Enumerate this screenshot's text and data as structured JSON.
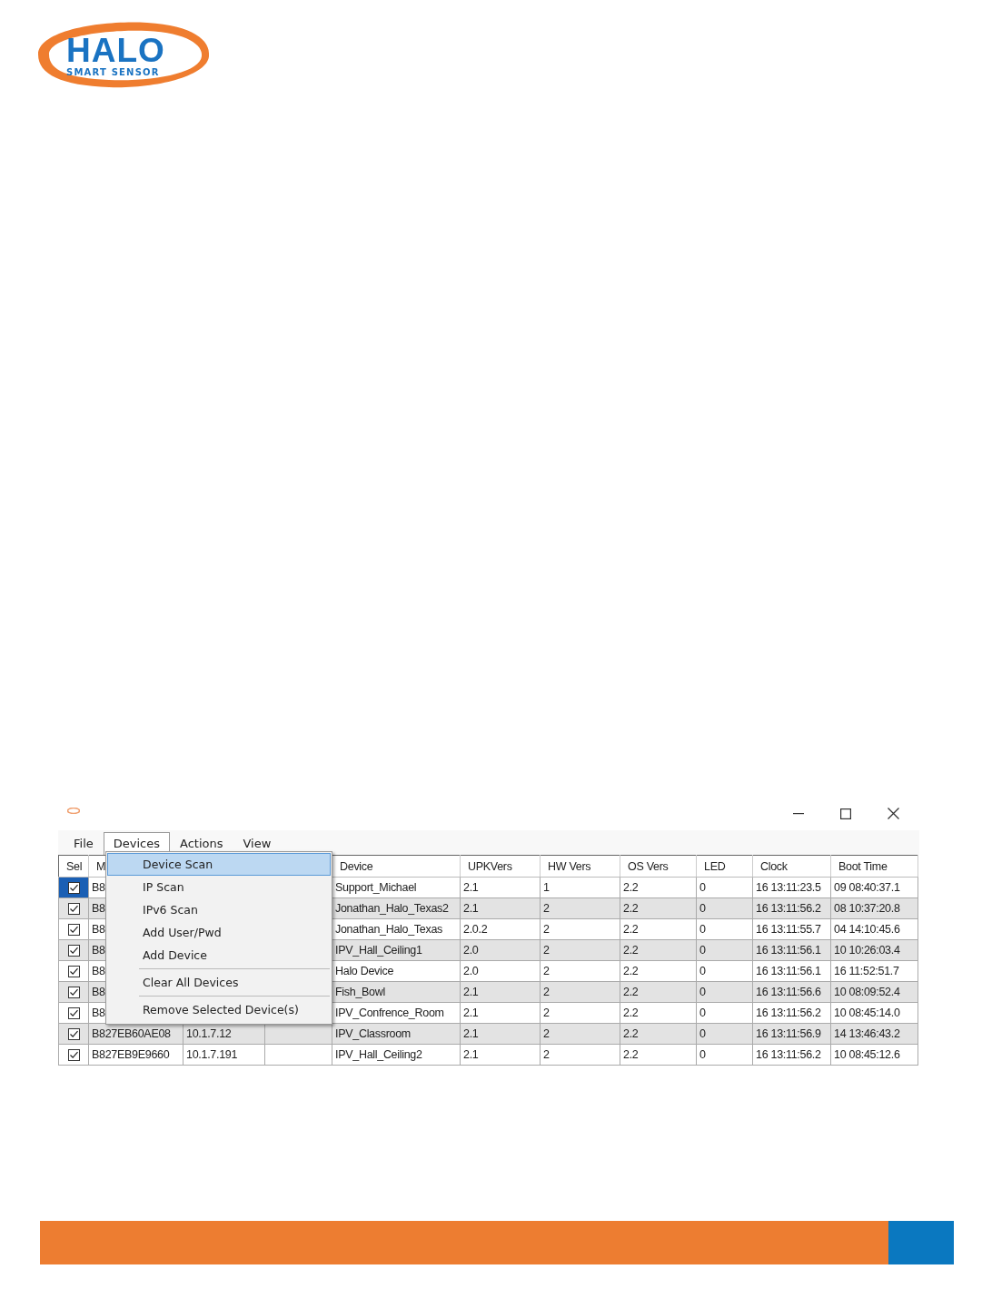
{
  "logo": {
    "title": "HALO",
    "subtitle": "SMART SENSOR"
  },
  "menubar": [
    {
      "label": "File",
      "open": false
    },
    {
      "label": "Devices",
      "open": true
    },
    {
      "label": "Actions",
      "open": false
    },
    {
      "label": "View",
      "open": false
    }
  ],
  "menu": [
    {
      "kind": "item",
      "label": "Device Scan",
      "selected": true
    },
    {
      "kind": "item",
      "label": "IP Scan",
      "selected": false
    },
    {
      "kind": "item",
      "label": "IPv6 Scan",
      "selected": false
    },
    {
      "kind": "item",
      "label": "Add User/Pwd",
      "selected": false
    },
    {
      "kind": "item",
      "label": "Add Device",
      "selected": false
    },
    {
      "kind": "separator"
    },
    {
      "kind": "item",
      "label": "Clear All Devices",
      "selected": false
    },
    {
      "kind": "separator"
    },
    {
      "kind": "item",
      "label": "Remove Selected Device(s)",
      "selected": false
    }
  ],
  "table": {
    "select_column": "Sel",
    "columns": [
      "M",
      null,
      null,
      "Device",
      "UPKVers",
      "HW Vers",
      "OS Vers",
      "LED",
      "Clock",
      "Boot Time"
    ],
    "rows": [
      {
        "checked": true,
        "selected": true,
        "cells": [
          "B8",
          null,
          null,
          "Support_Michael",
          "2.1",
          "1",
          "2.2",
          "0",
          "16 13:11:23.5",
          "09 08:40:37.1"
        ]
      },
      {
        "checked": true,
        "selected": false,
        "cells": [
          "B8",
          null,
          null,
          "Jonathan_Halo_Texas2",
          "2.1",
          "2",
          "2.2",
          "0",
          "16 13:11:56.2",
          "08 10:37:20.8"
        ]
      },
      {
        "checked": true,
        "selected": false,
        "cells": [
          "B8",
          null,
          null,
          "Jonathan_Halo_Texas",
          "2.0.2",
          "2",
          "2.2",
          "0",
          "16 13:11:55.7",
          "04 14:10:45.6"
        ]
      },
      {
        "checked": true,
        "selected": false,
        "cells": [
          "B8",
          null,
          null,
          "IPV_Hall_Ceiling1",
          "2.0",
          "2",
          "2.2",
          "0",
          "16 13:11:56.1",
          "10 10:26:03.4"
        ]
      },
      {
        "checked": true,
        "selected": false,
        "cells": [
          "B8",
          null,
          null,
          "Halo Device",
          "2.0",
          "2",
          "2.2",
          "0",
          "16 13:11:56.1",
          "16 11:52:51.7"
        ]
      },
      {
        "checked": true,
        "selected": false,
        "cells": [
          "B8",
          null,
          null,
          "Fish_Bowl",
          "2.1",
          "2",
          "2.2",
          "0",
          "16 13:11:56.6",
          "10 08:09:52.4"
        ]
      },
      {
        "checked": true,
        "selected": false,
        "cells": [
          "B8",
          null,
          null,
          "IPV_Confrence_Room",
          "2.1",
          "2",
          "2.2",
          "0",
          "16 13:11:56.2",
          "10 08:45:14.0"
        ]
      },
      {
        "checked": true,
        "selected": false,
        "cells": [
          "B827EB60AE08",
          "10.1.7.12",
          null,
          "IPV_Classroom",
          "2.1",
          "2",
          "2.2",
          "0",
          "16 13:11:56.9",
          "14 13:46:43.2"
        ]
      },
      {
        "checked": true,
        "selected": false,
        "cells": [
          "B827EB9E9660",
          "10.1.7.191",
          null,
          "IPV_Hall_Ceiling2",
          "2.1",
          "2",
          "2.2",
          "0",
          "16 13:11:56.2",
          "10 08:45:12.6"
        ]
      }
    ]
  }
}
